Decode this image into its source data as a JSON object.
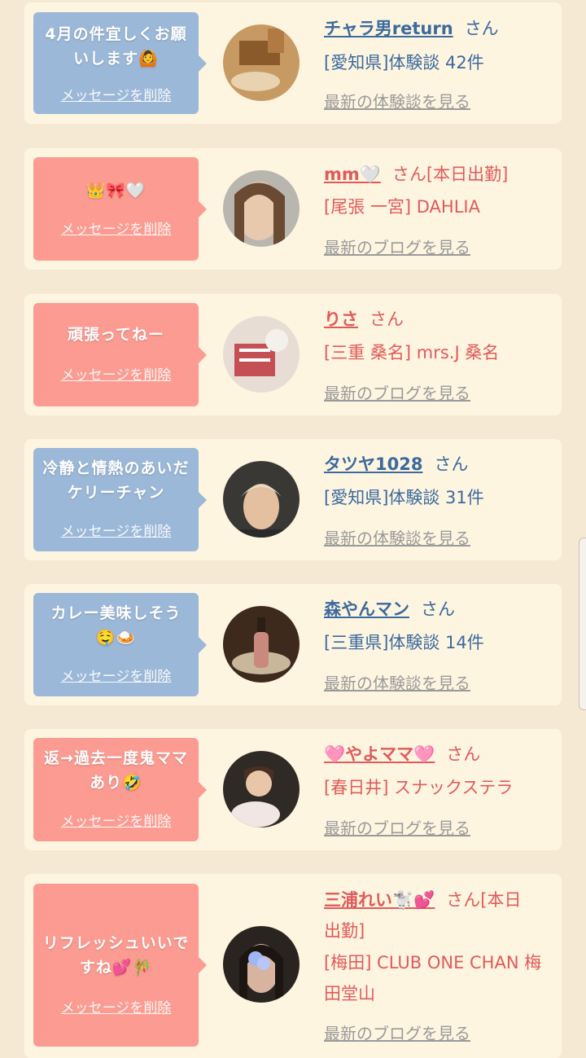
{
  "delete_label": "メッセージを削除",
  "san_label": "さん",
  "colors": {
    "blue_bubble": "#9cb8d8",
    "pink_bubble": "#fc9b91",
    "blue_text": "#3b6a9d",
    "pink_text": "#e05a5a"
  },
  "entries": [
    {
      "message": "4月の件宜しくお願いします🙆",
      "name": "チャラ男return",
      "status": "",
      "detail": "[愛知県]体験談 42件",
      "link": "最新の体験談を見る"
    },
    {
      "message": "👑🎀🤍",
      "name": "mm🤍",
      "status": "[本日出勤]",
      "detail": "[尾張 一宮] DAHLIA",
      "link": "最新のブログを見る"
    },
    {
      "message": "頑張ってねー",
      "name": "りさ",
      "status": "",
      "detail": "[三重 桑名] mrs.J 桑名",
      "link": "最新のブログを見る"
    },
    {
      "message": "冷静と情熱のあいだケリーチャン",
      "name": "タツヤ1028",
      "status": "",
      "detail": "[愛知県]体験談 31件",
      "link": "最新の体験談を見る"
    },
    {
      "message": "カレー美味しそう 🤤🍛",
      "name": "森やんマン",
      "status": "",
      "detail": "[三重県]体験談 14件",
      "link": "最新の体験談を見る"
    },
    {
      "message": "返→過去一度鬼ママあり🤣",
      "name": "🩷やよママ🩷",
      "status": "",
      "detail": "[春日井] スナックステラ",
      "link": "最新のブログを見る"
    },
    {
      "message": "リフレッシュいいですね💕🎋",
      "name": "三浦れい🐩💕",
      "status": "[本日",
      "status_line2": "出勤]",
      "detail": "[梅田] CLUB ONE CHAN 梅",
      "detail_line2": "田堂山",
      "link": "最新のブログを見る"
    }
  ]
}
